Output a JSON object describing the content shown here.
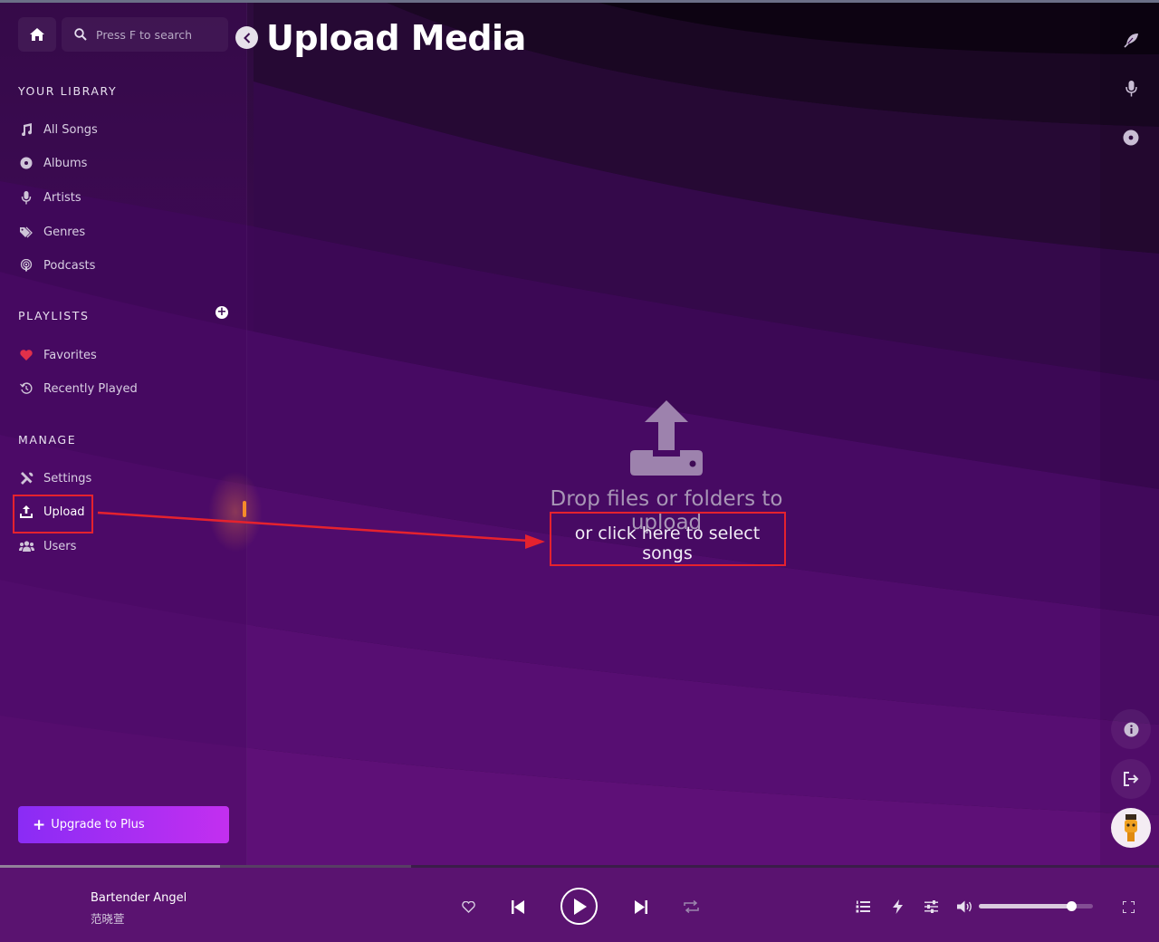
{
  "header": {
    "title": "Upload Media",
    "search_placeholder": "Press F to search"
  },
  "sidebar": {
    "library_title": "YOUR LIBRARY",
    "library_items": [
      {
        "label": "All Songs",
        "icon": "music-note-icon"
      },
      {
        "label": "Albums",
        "icon": "disc-icon"
      },
      {
        "label": "Artists",
        "icon": "microphone-icon"
      },
      {
        "label": "Genres",
        "icon": "tags-icon"
      },
      {
        "label": "Podcasts",
        "icon": "podcast-icon"
      }
    ],
    "playlists_title": "PLAYLISTS",
    "playlist_items": [
      {
        "label": "Favorites",
        "icon": "heart-icon"
      },
      {
        "label": "Recently Played",
        "icon": "history-icon"
      }
    ],
    "manage_title": "MANAGE",
    "manage_items": [
      {
        "label": "Settings",
        "icon": "tools-icon"
      },
      {
        "label": "Upload",
        "icon": "upload-icon"
      },
      {
        "label": "Users",
        "icon": "users-icon"
      }
    ],
    "upgrade_label": "Upgrade to Plus"
  },
  "dropzone": {
    "primary_text": "Drop files or folders to upload",
    "secondary_text": "or click here to select songs"
  },
  "player": {
    "song_title": "Bartender Angel",
    "song_artist": "范晓萱",
    "progress_fraction": 0.19,
    "buffer_fraction": 0.355,
    "volume_fraction": 0.81
  },
  "colors": {
    "accent_start": "#8a2cf5",
    "accent_end": "#c32ff0",
    "annotation": "#e5222e",
    "favorite_heart": "#e0304a"
  }
}
